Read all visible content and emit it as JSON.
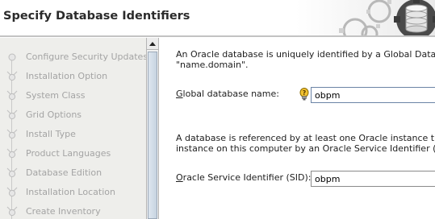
{
  "header": {
    "title": "Specify Database Identifiers",
    "graphic_icon": "gears-database-icon"
  },
  "sidebar": {
    "steps": [
      {
        "label": "Configure Security Updates"
      },
      {
        "label": "Installation Option"
      },
      {
        "label": "System Class"
      },
      {
        "label": "Grid Options"
      },
      {
        "label": "Install Type"
      },
      {
        "label": "Product Languages"
      },
      {
        "label": "Database Edition"
      },
      {
        "label": "Installation Location"
      },
      {
        "label": "Create Inventory"
      }
    ]
  },
  "main": {
    "intro_line1": "An Oracle database is uniquely identified by a Global Databa",
    "intro_line2": "\"name.domain\".",
    "gdb": {
      "label_mnemonic": "G",
      "label_rest": "lobal database name:",
      "value": "obpm",
      "hint_icon": "lightbulb-icon"
    },
    "sid_line1": "A database is referenced by at least one Oracle instance that",
    "sid_line2": "instance on this computer by an Oracle Service Identifier (SID",
    "sid": {
      "label_mnemonic": "O",
      "label_rest": "racle Service Identifier (SID):",
      "value": "obpm"
    }
  },
  "colors": {
    "sidebar_bg": "#eeeeeb",
    "step_text": "#a4a4a4",
    "accent_border": "#6b84a6"
  }
}
